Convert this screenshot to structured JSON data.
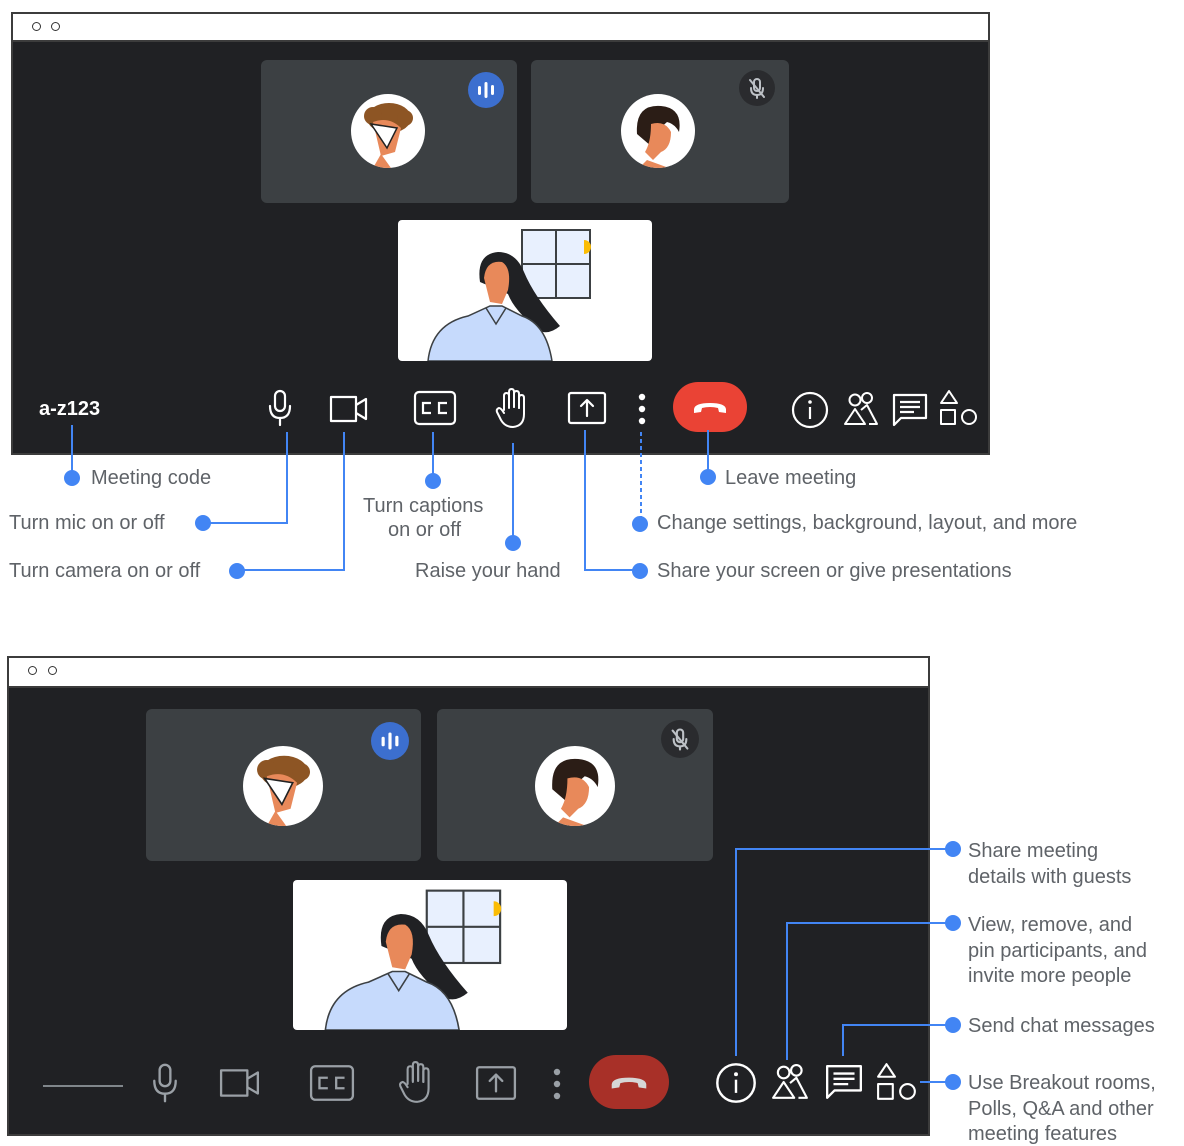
{
  "top_window": {
    "meeting_code": "a-z123",
    "participants": [
      {
        "name": "participant-speaking",
        "status_icon": "audio-wave-icon"
      },
      {
        "name": "participant-muted",
        "status_icon": "mic-off-icon"
      }
    ],
    "controls": [
      "mic-icon",
      "camera-icon",
      "captions-icon",
      "raise-hand-icon",
      "present-icon",
      "more-options-icon",
      "leave-call-icon",
      "info-icon",
      "people-icon",
      "chat-icon",
      "activities-icon"
    ]
  },
  "bottom_window": {
    "controls": [
      "mic-icon",
      "camera-icon",
      "captions-icon",
      "raise-hand-icon",
      "present-icon",
      "more-options-icon",
      "leave-call-icon",
      "info-icon",
      "people-icon",
      "chat-icon",
      "activities-icon"
    ]
  },
  "annotations": {
    "meeting_code": "Meeting code",
    "mic": "Turn mic on or off",
    "camera": "Turn camera on or off",
    "captions_line1": "Turn captions",
    "captions_line2": "on or off",
    "raise_hand": "Raise your hand",
    "leave": "Leave meeting",
    "more": "Change settings, background, layout, and more",
    "present": "Share your screen or give presentations",
    "info_line1": "Share meeting",
    "info_line2": "details with guests",
    "people_line1": "View, remove, and",
    "people_line2": "pin participants, and",
    "people_line3": "invite more people",
    "chat": "Send chat messages",
    "activities_line1": "Use Breakout rooms,",
    "activities_line2": "Polls, Q&A and other",
    "activities_line3": "meeting features"
  },
  "colors": {
    "meet_background": "#202124",
    "tile": "#3c4043",
    "accent_blue": "#4285f4",
    "leave_red": "#ea4335",
    "leave_red_dim": "#a83028",
    "annotation_text": "#5f6368"
  }
}
